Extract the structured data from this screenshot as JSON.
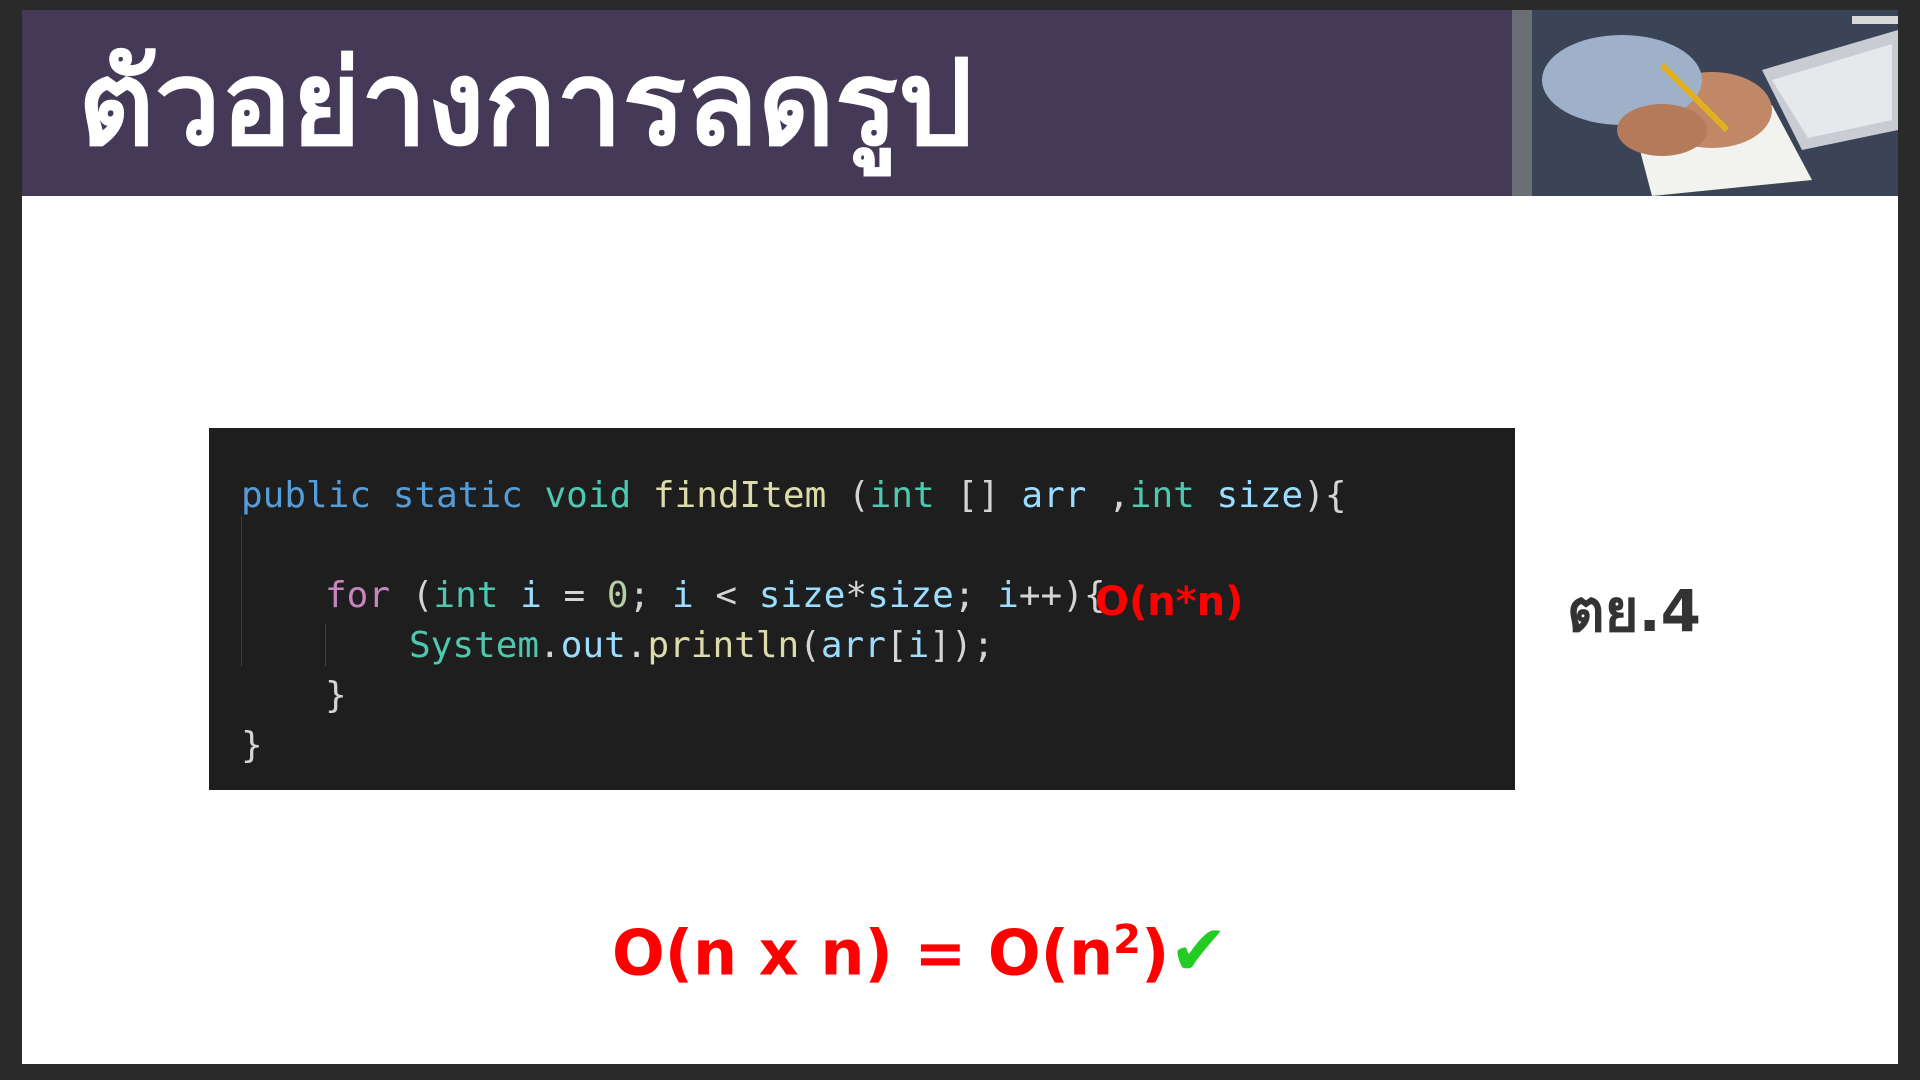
{
  "slide": {
    "title": "ตัวอย่างการลดรูป",
    "example_label": "ตย.4",
    "photo_icon": "person-writing-photo"
  },
  "code": {
    "line1": {
      "t1": "public",
      "t2": "static",
      "t3": "void",
      "t4": "findItem",
      "t5": "(",
      "t6": "int",
      "t7": "[]",
      "t8": "arr",
      "t9": ",",
      "t10": "int",
      "t11": "size",
      "t12": "){"
    },
    "line2": {
      "t1": "for",
      "t2": "(",
      "t3": "int",
      "t4": "i",
      "t5": "=",
      "t6": "0",
      "t7": ";",
      "t8": "i",
      "t9": "<",
      "t10": "size",
      "t11": "*",
      "t12": "size",
      "t13": ";",
      "t14": "i",
      "t15": "++){"
    },
    "line3": {
      "t1": "System",
      "t2": ".",
      "t3": "out",
      "t4": ".",
      "t5": "println",
      "t6": "(",
      "t7": "arr",
      "t8": "[",
      "t9": "i",
      "t10": "]);"
    },
    "line4": "}",
    "line5": "}"
  },
  "annotation": "O(n*n)",
  "result": {
    "main": "O(n x n) = O(n",
    "superscript": "2",
    "close": ")",
    "check": "✔"
  },
  "colors": {
    "title_bar": "#443a58",
    "code_bg": "#1e1e1e",
    "annotation": "#ff0000",
    "check": "#22cc22"
  }
}
